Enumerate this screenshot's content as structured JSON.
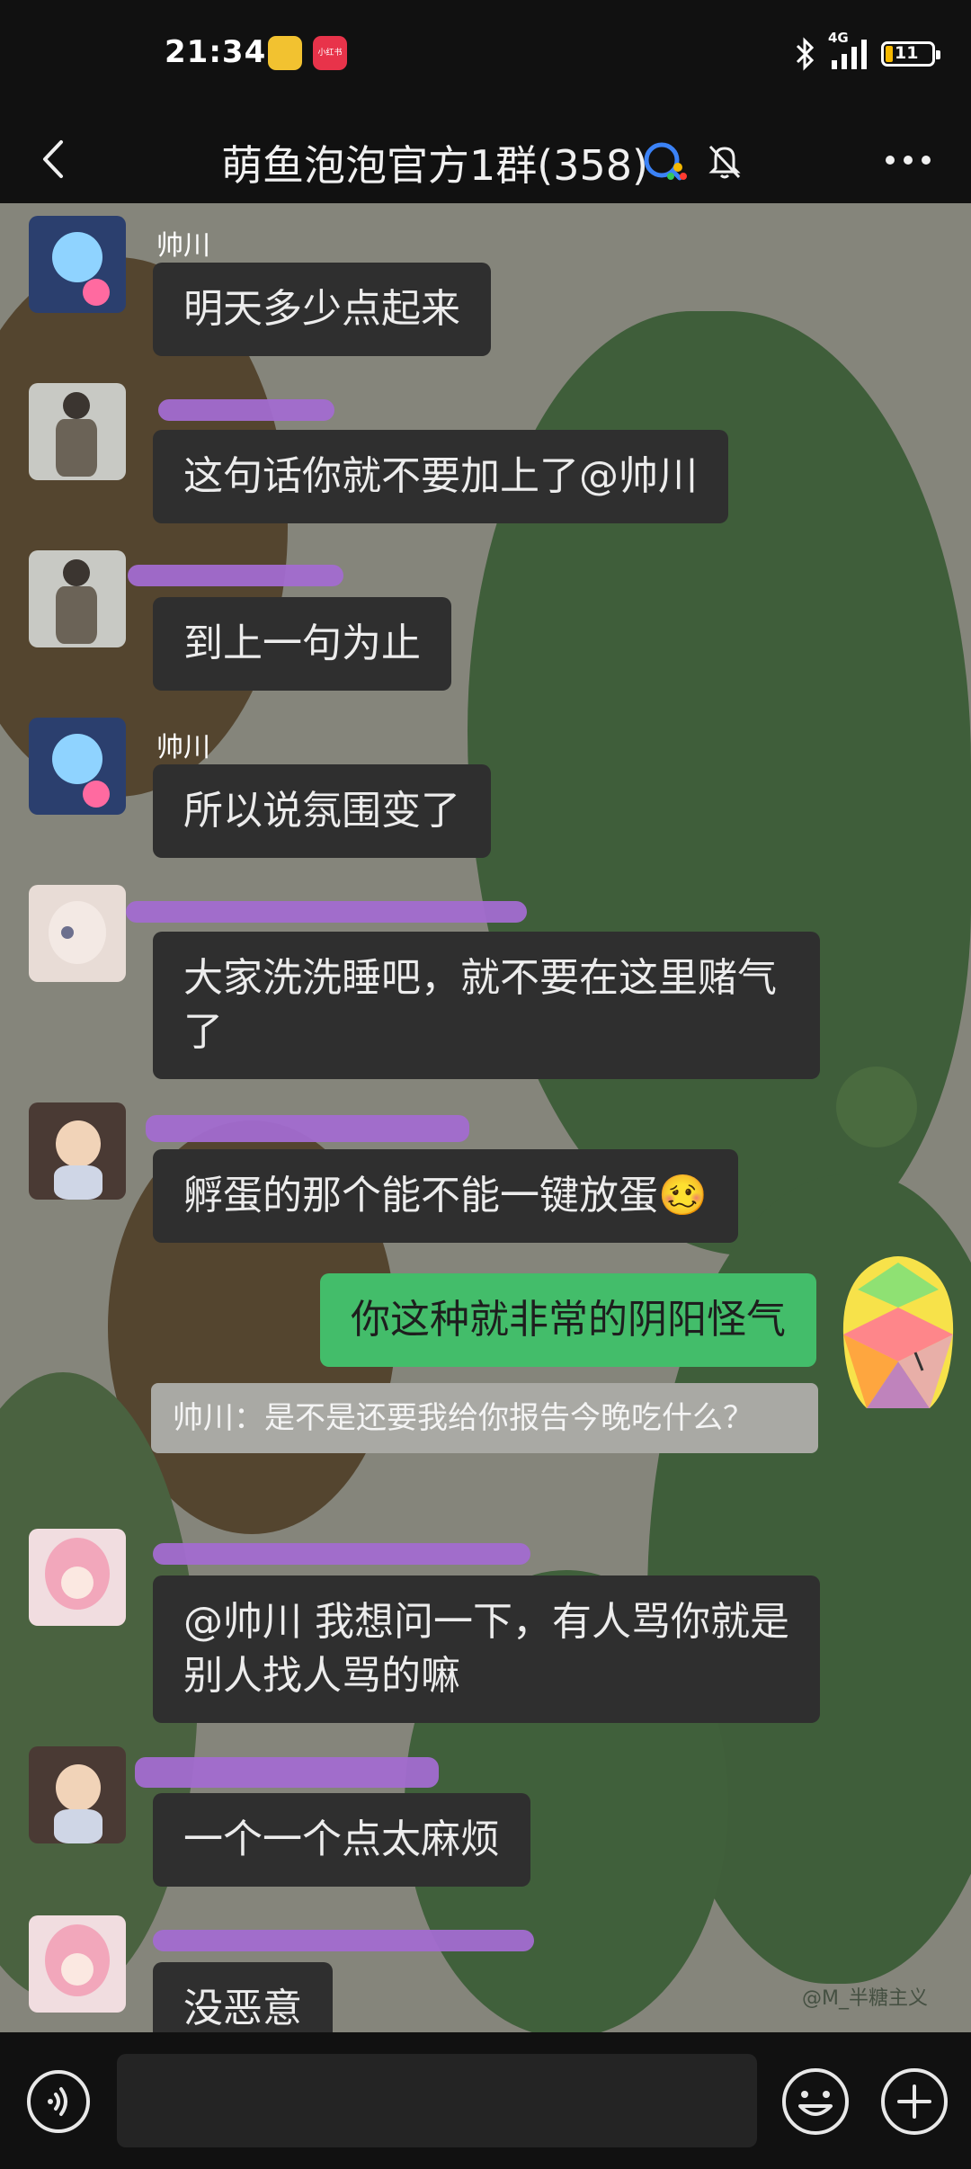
{
  "status_bar": {
    "time": "21:34",
    "app_badge_2": "小红书",
    "network": "4G",
    "battery": "11",
    "battery_level_percent": 11
  },
  "header": {
    "title": "萌鱼泡泡官方1群(358)",
    "icons": [
      "back-icon",
      "group-chat-icon",
      "mute-bell-icon",
      "more-icon"
    ]
  },
  "messages": [
    {
      "sender": "帅川",
      "text": "明天多少点起来"
    },
    {
      "sender": "",
      "text": "这句话你就不要加上了@帅川"
    },
    {
      "sender": "",
      "text": "到上一句为止"
    },
    {
      "sender": "帅川",
      "text": "所以说氛围变了"
    },
    {
      "sender": "",
      "text": "大家洗洗睡吧，就不要在这里赌气了"
    },
    {
      "sender": "",
      "text": "孵蛋的那个能不能一键放蛋🥴"
    },
    {
      "sender": "me",
      "text": "你这种就非常的阴阳怪气",
      "quote": "帅川：是不是还要我给你报告今晚吃什么？"
    },
    {
      "sender": "",
      "text": "@帅川  我想问一下，有人骂你就是别人找人骂的嘛"
    },
    {
      "sender": "",
      "text": "一个一个点太麻烦"
    },
    {
      "sender": "",
      "text": "没恶意"
    }
  ],
  "watermark": "@M_半糖主义",
  "colors": {
    "background": "#111111",
    "bubble_other": "#2f2f2f",
    "bubble_mine": "#43bd6a",
    "redaction": "#a26bd0"
  },
  "input_bar": {
    "icons": [
      "voice-icon",
      "emoji-icon",
      "plus-icon"
    ]
  }
}
